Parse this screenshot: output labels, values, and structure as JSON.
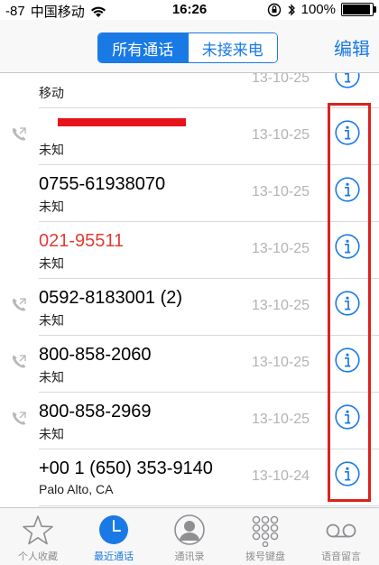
{
  "status_bar": {
    "signal": "-87",
    "carrier": "中国移动",
    "time": "16:26",
    "battery": "100%",
    "battery_level": 1.0
  },
  "nav": {
    "segments": [
      "所有通话",
      "未接来电"
    ],
    "active_segment": 0,
    "edit_label": "编辑"
  },
  "calls": [
    {
      "number": "",
      "label": "移动",
      "date": "13-10-25",
      "missed": false,
      "outgoing": false,
      "partial": true
    },
    {
      "number": "",
      "label": "未知",
      "date": "13-10-25",
      "missed": false,
      "outgoing": true,
      "redacted": true
    },
    {
      "number": "0755-61938070",
      "label": "未知",
      "date": "13-10-25",
      "missed": false,
      "outgoing": false
    },
    {
      "number": "021-95511",
      "label": "未知",
      "date": "13-10-25",
      "missed": true,
      "outgoing": false
    },
    {
      "number": "0592-8183001  (2)",
      "label": "未知",
      "date": "13-10-25",
      "missed": false,
      "outgoing": true
    },
    {
      "number": "800-858-2060",
      "label": "未知",
      "date": "13-10-25",
      "missed": false,
      "outgoing": true
    },
    {
      "number": "800-858-2969",
      "label": "未知",
      "date": "13-10-25",
      "missed": false,
      "outgoing": true
    },
    {
      "number": "+00 1 (650) 353-9140",
      "label": "Palo Alto, CA",
      "date": "13-10-24",
      "missed": false,
      "outgoing": false
    }
  ],
  "tabs": [
    {
      "label": "个人收藏",
      "icon": "star-icon"
    },
    {
      "label": "最近通话",
      "icon": "clock-icon"
    },
    {
      "label": "通讯录",
      "icon": "contact-icon"
    },
    {
      "label": "拨号键盘",
      "icon": "keypad-icon"
    },
    {
      "label": "语音留言",
      "icon": "voicemail-icon"
    }
  ],
  "active_tab": 1,
  "colors": {
    "accent": "#1a7ae5",
    "missed": "#e03c32",
    "annotation": "#d9231d"
  }
}
